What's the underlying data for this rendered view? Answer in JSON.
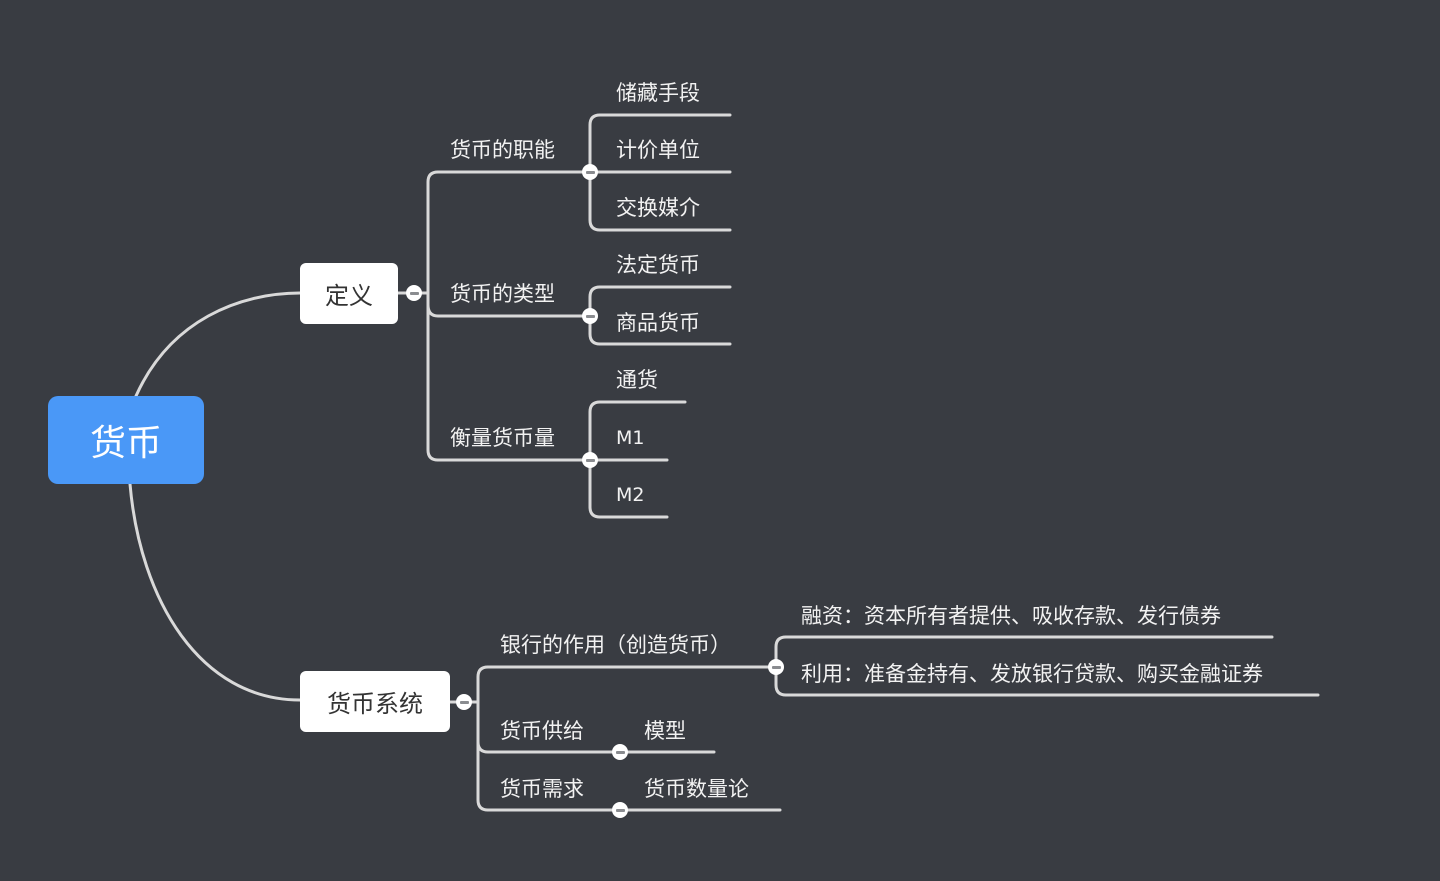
{
  "root": {
    "label": "货币"
  },
  "branches": [
    {
      "label": "定义",
      "children": [
        {
          "label": "货币的职能",
          "children": [
            "储藏手段",
            "计价单位",
            "交换媒介"
          ]
        },
        {
          "label": "货币的类型",
          "children": [
            "法定货币",
            "商品货币"
          ]
        },
        {
          "label": "衡量货币量",
          "children": [
            "通货",
            "M1",
            "M2"
          ]
        }
      ]
    },
    {
      "label": "货币系统",
      "children": [
        {
          "label": "银行的作用（创造货币）",
          "children": [
            "融资：资本所有者提供、吸收存款、发行债券",
            "利用：准备金持有、发放银行贷款、购买金融证券"
          ]
        },
        {
          "label": "货币供给",
          "children": [
            "模型"
          ]
        },
        {
          "label": "货币需求",
          "children": [
            "货币数量论"
          ]
        }
      ]
    }
  ],
  "colors": {
    "background": "#393c42",
    "root_fill": "#4a98f7",
    "main_fill": "#ffffff",
    "line": "#d9d9d9",
    "text": "#f2f2f2"
  }
}
